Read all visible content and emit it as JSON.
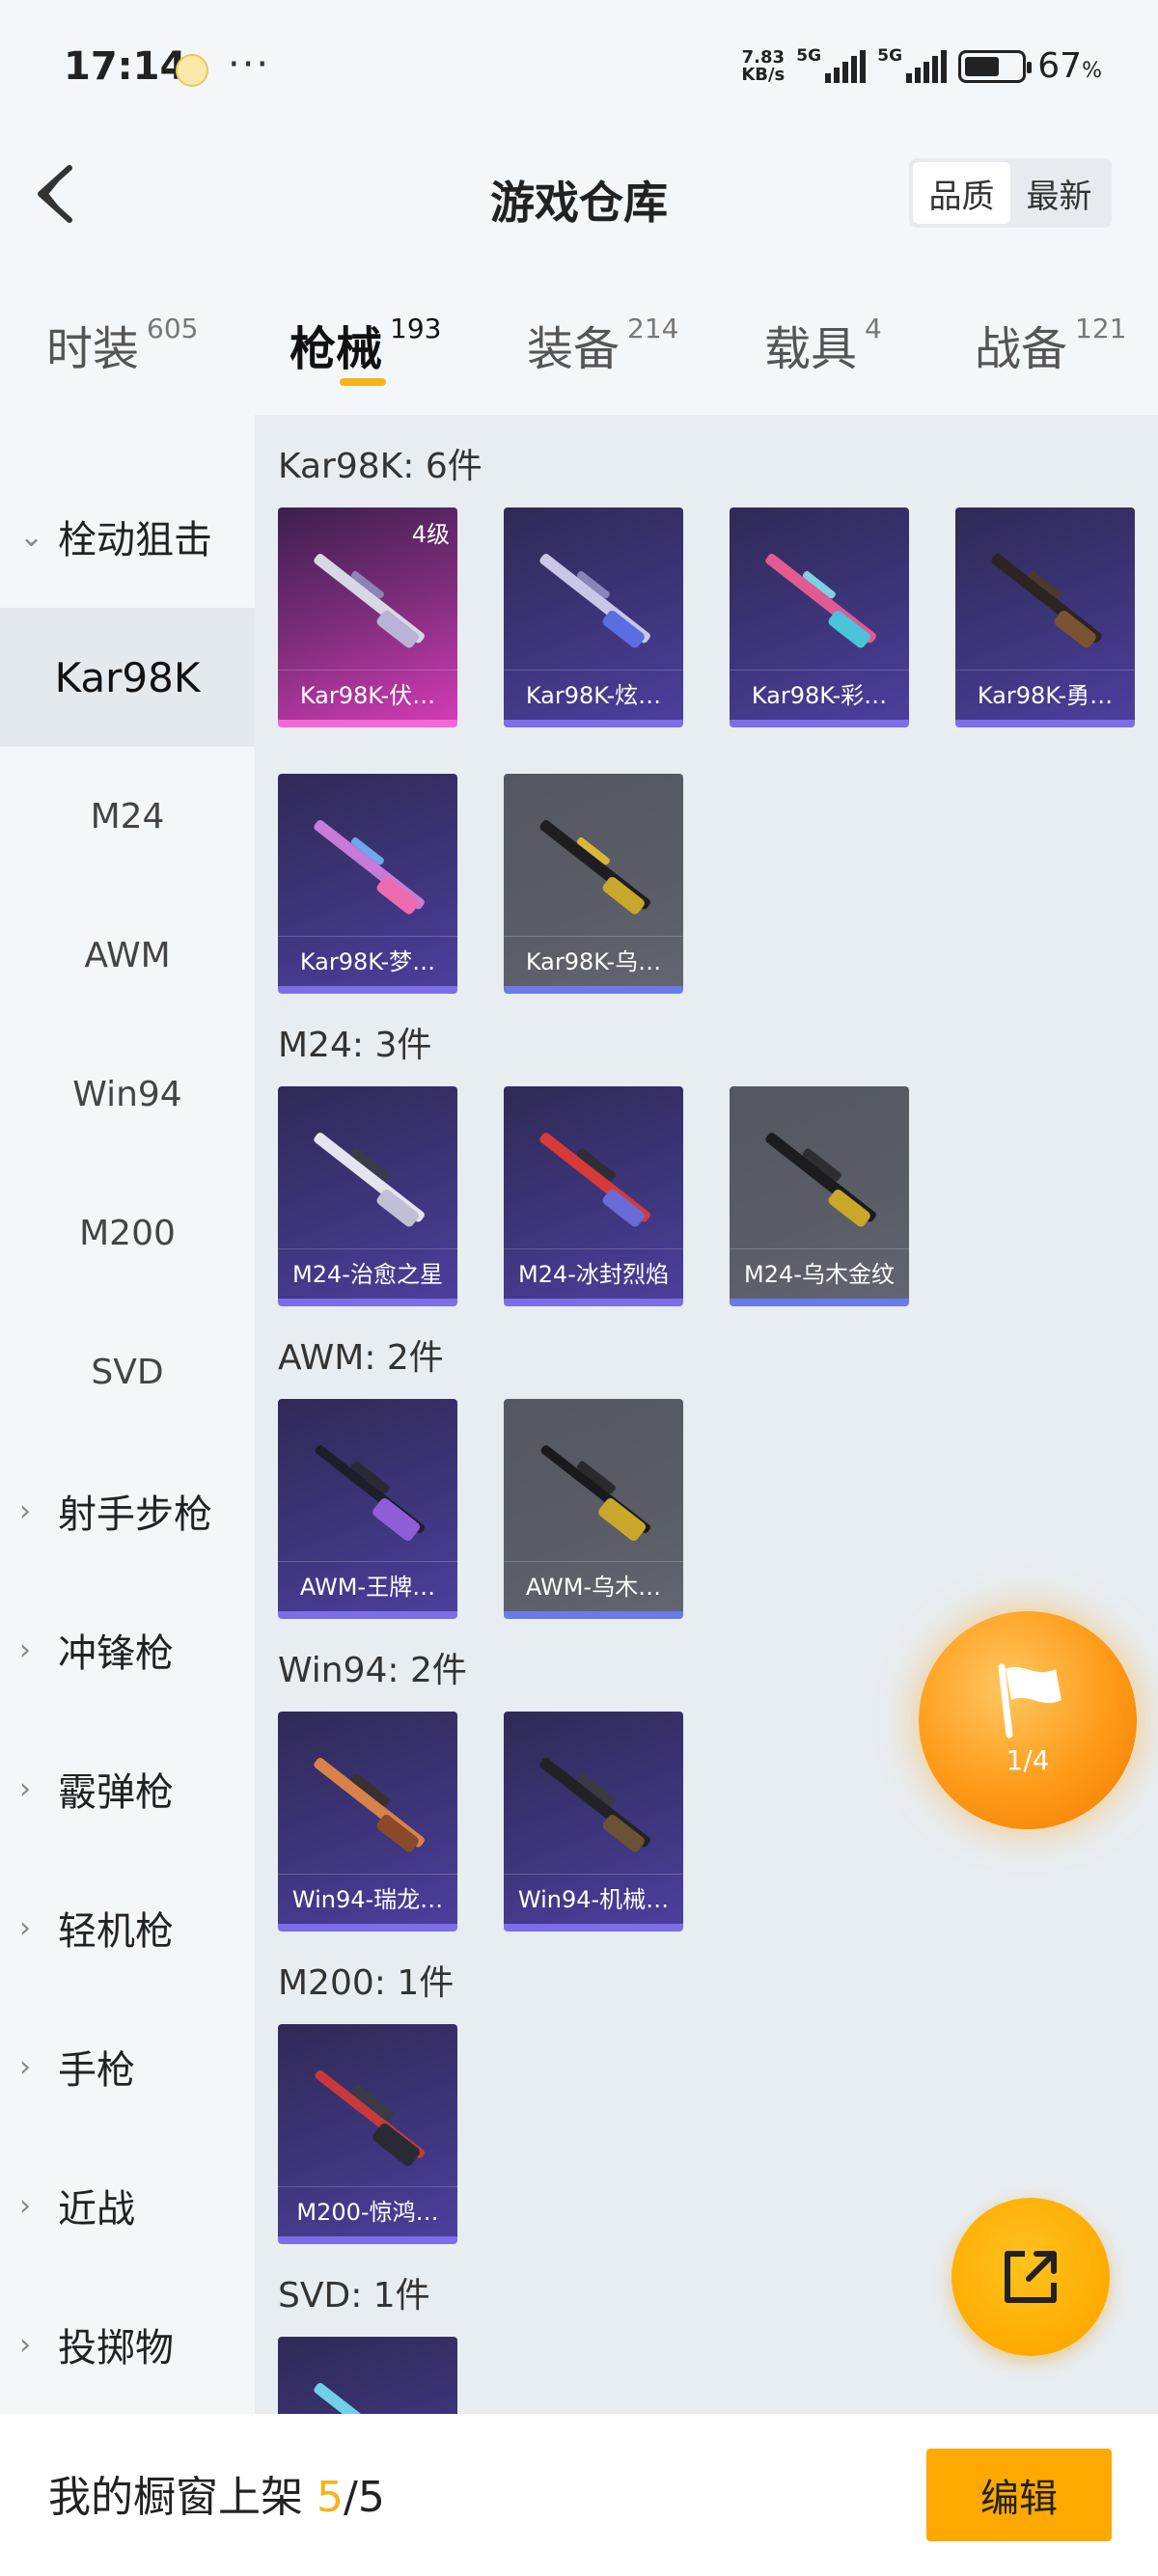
{
  "status_bar": {
    "time": "17:14",
    "more": "···",
    "net_speed_value": "7.83",
    "net_speed_unit": "KB/s",
    "sim1": "5G",
    "sim2": "5G",
    "battery_percent": "67",
    "battery_unit": "%"
  },
  "header": {
    "title": "游戏仓库",
    "sort_options": [
      "品质",
      "最新"
    ],
    "sort_selected": "品质"
  },
  "tabs": [
    {
      "label": "时装",
      "count": "605"
    },
    {
      "label": "枪械",
      "count": "193",
      "active": true
    },
    {
      "label": "装备",
      "count": "214"
    },
    {
      "label": "载具",
      "count": "4"
    },
    {
      "label": "战备",
      "count": "121"
    }
  ],
  "sidebar": {
    "group_bolt": "栓动狙击",
    "sub_kar98k": "Kar98K",
    "sub_m24": "M24",
    "sub_awm": "AWM",
    "sub_win94": "Win94",
    "sub_m200": "M200",
    "sub_svd": "SVD",
    "group_dmr": "射手步枪",
    "group_smg": "冲锋枪",
    "group_shotgun": "霰弹枪",
    "group_lmg": "轻机枪",
    "group_pistol": "手枪",
    "group_melee": "近战",
    "group_throwable": "投掷物"
  },
  "sections": {
    "kar98k": {
      "title": "Kar98K: 6件",
      "items": [
        {
          "name": "Kar98K-伏…",
          "level": "4级"
        },
        {
          "name": "Kar98K-炫…"
        },
        {
          "name": "Kar98K-彩…"
        },
        {
          "name": "Kar98K-勇…"
        },
        {
          "name": "Kar98K-梦…"
        },
        {
          "name": "Kar98K-乌…"
        }
      ]
    },
    "m24": {
      "title": "M24: 3件",
      "items": [
        {
          "name": "M24-治愈之星"
        },
        {
          "name": "M24-冰封烈焰"
        },
        {
          "name": "M24-乌木金纹"
        }
      ]
    },
    "awm": {
      "title": "AWM: 2件",
      "items": [
        {
          "name": "AWM-王牌…"
        },
        {
          "name": "AWM-乌木…"
        }
      ]
    },
    "win94": {
      "title": "Win94: 2件",
      "items": [
        {
          "name": "Win94-瑞龙…"
        },
        {
          "name": "Win94-机械…"
        }
      ]
    },
    "m200": {
      "title": "M200: 1件",
      "items": [
        {
          "name": "M200-惊鸿…"
        }
      ]
    },
    "svd": {
      "title": "SVD: 1件"
    }
  },
  "floating": {
    "flag_page": "1/4",
    "flag_icon": "flag-icon",
    "share_icon": "share-icon"
  },
  "bottom_bar": {
    "showcase_label": "我的橱窗上架",
    "showcase_current": "5",
    "showcase_total": "/5",
    "edit_label": "编辑"
  },
  "colors": {
    "accent": "#f5b41a",
    "edit_button": "#ffa800",
    "card_purple": "#3a3374",
    "card_pink": "#d23bb5",
    "card_grey": "#5a5d66"
  }
}
